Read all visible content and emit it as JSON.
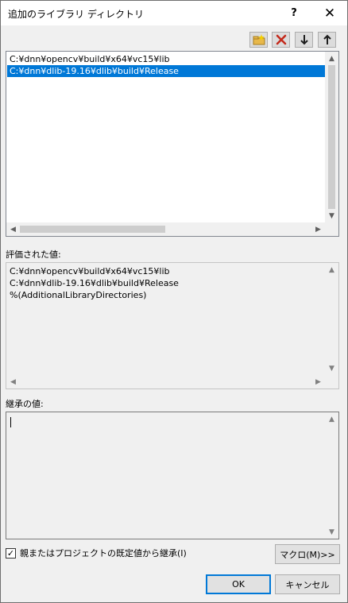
{
  "dialog": {
    "title": "追加のライブラリ ディレクトリ",
    "help": "?",
    "close": "✕"
  },
  "toolbar": {
    "new_line_icon": "new-folder-icon",
    "delete_icon": "red-x-icon",
    "move_down_icon": "arrow-down-icon",
    "move_up_icon": "arrow-up-icon",
    "delete_color": "#c42b1c"
  },
  "list": {
    "items": [
      "C:¥dnn¥opencv¥build¥x64¥vc15¥lib",
      "C:¥dnn¥dlib-19.16¥dlib¥build¥Release"
    ],
    "selected_index": 1,
    "selection_color": "#0078d7"
  },
  "evaluated": {
    "label": "評価された値:",
    "lines": [
      "C:¥dnn¥opencv¥build¥x64¥vc15¥lib",
      "C:¥dnn¥dlib-19.16¥dlib¥build¥Release",
      "%(AdditionalLibraryDirectories)"
    ]
  },
  "inherited": {
    "label": "継承の値:",
    "value": ""
  },
  "options": {
    "inherit_label": "親またはプロジェクトの既定値から継承(I)",
    "inherit_checked": true
  },
  "buttons": {
    "macro": "マクロ(M)>>",
    "ok": "OK",
    "cancel": "キャンセル"
  }
}
